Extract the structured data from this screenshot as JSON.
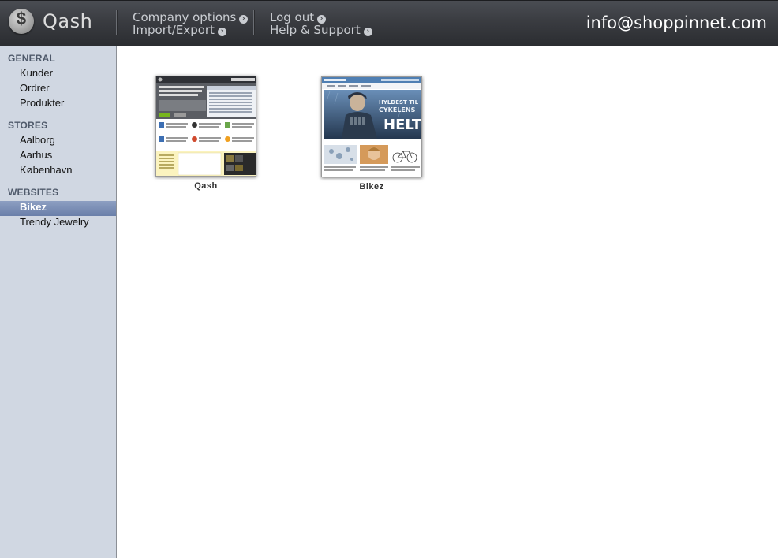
{
  "header": {
    "logo_symbol": "$",
    "app_name": "Qash",
    "nav": {
      "company_options": "Company options",
      "import_export": "Import/Export",
      "log_out": "Log out",
      "help_support": "Help & Support"
    },
    "account_email": "info@shoppinnet.com"
  },
  "sidebar": {
    "general": {
      "heading": "GENERAL",
      "items": [
        "Kunder",
        "Ordrer",
        "Produkter"
      ]
    },
    "stores": {
      "heading": "STORES",
      "items": [
        "Aalborg",
        "Aarhus",
        "København"
      ]
    },
    "websites": {
      "heading": "WEBSITES",
      "items": [
        "Bikez",
        "Trendy Jewelry"
      ],
      "active": "Bikez"
    }
  },
  "websites": [
    {
      "name": "Qash"
    },
    {
      "name": "Bikez"
    }
  ]
}
